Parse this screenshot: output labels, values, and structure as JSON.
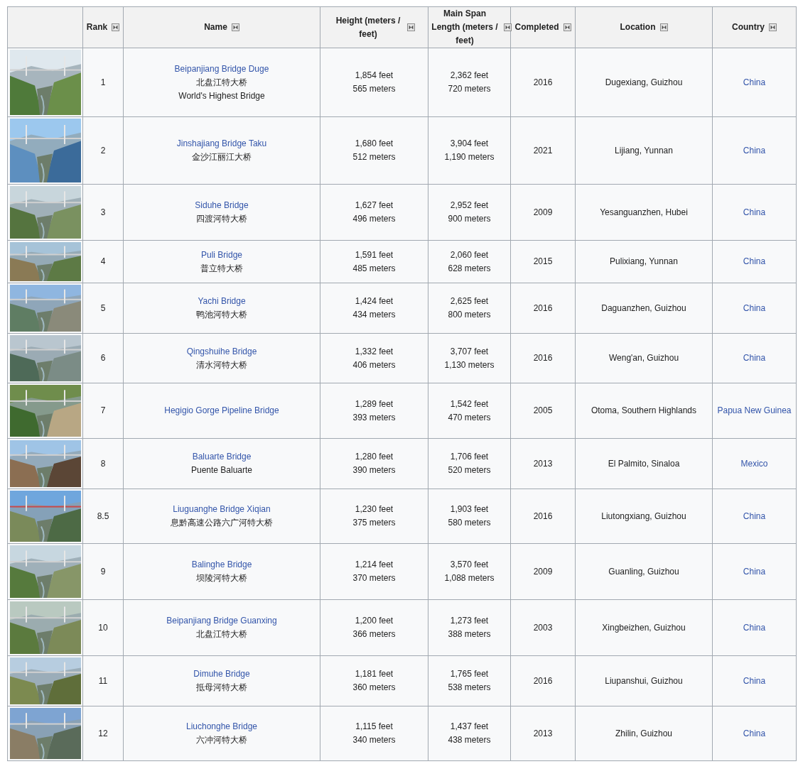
{
  "table": {
    "columns": [
      {
        "sortable": false
      },
      {
        "label": "Rank",
        "sortable": true
      },
      {
        "label": "Name",
        "sortable": true
      },
      {
        "label": "Height (meters / feet)",
        "sortable": true
      },
      {
        "label": "Main Span Length (meters / feet)",
        "sortable": true
      },
      {
        "label": "Completed",
        "sortable": true
      },
      {
        "label": "Location",
        "sortable": true
      },
      {
        "label": "Country",
        "sortable": true
      }
    ],
    "rows": [
      {
        "image": {
          "kind": "picture"
        },
        "rank": "1",
        "name": "Beipanjiang Bridge Duge",
        "subtitles": [
          "北盘江特大桥",
          "World's Highest Bridge"
        ],
        "height": [
          "1,854 feet",
          "565 meters"
        ],
        "span": [
          "2,362 feet",
          "720 meters"
        ],
        "completed": "2016",
        "location": "Dugexiang, Guizhou",
        "country": "China"
      },
      {
        "image": {
          "kind": "picture"
        },
        "rank": "2",
        "name": "Jinshajiang Bridge Taku",
        "subtitles": [
          "金沙江丽江大桥"
        ],
        "height": [
          "1,680 feet",
          "512 meters"
        ],
        "span": [
          "3,904 feet",
          "1,190 meters"
        ],
        "completed": "2021",
        "location": "Lijiang, Yunnan",
        "country": "China"
      },
      {
        "image": {
          "kind": "picture"
        },
        "rank": "3",
        "name": "Siduhe Bridge",
        "subtitles": [
          "四渡河特大桥"
        ],
        "height": [
          "1,627 feet",
          "496 meters"
        ],
        "span": [
          "2,952 feet",
          "900 meters"
        ],
        "completed": "2009",
        "location": "Yesanguanzhen, Hubei",
        "country": "China"
      },
      {
        "image": {
          "kind": "picture"
        },
        "rank": "4",
        "name": "Puli Bridge",
        "subtitles": [
          "普立特大桥"
        ],
        "height": [
          "1,591 feet",
          "485 meters"
        ],
        "span": [
          "2,060 feet",
          "628 meters"
        ],
        "completed": "2015",
        "location": "Pulixiang, Yunnan",
        "country": "China"
      },
      {
        "image": {
          "kind": "picture"
        },
        "rank": "5",
        "name": "Yachi Bridge",
        "subtitles": [
          "鸭池河特大桥"
        ],
        "height": [
          "1,424 feet",
          "434 meters"
        ],
        "span": [
          "2,625 feet",
          "800 meters"
        ],
        "completed": "2016",
        "location": "Daguanzhen, Guizhou",
        "country": "China"
      },
      {
        "image": {
          "kind": "picture"
        },
        "rank": "6",
        "name": "Qingshuihe Bridge",
        "subtitles": [
          "清水河特大桥"
        ],
        "height": [
          "1,332 feet",
          "406 meters"
        ],
        "span": [
          "3,707 feet",
          "1,130 meters"
        ],
        "completed": "2016",
        "location": "Weng'an, Guizhou",
        "country": "China"
      },
      {
        "image": {
          "kind": "picture"
        },
        "rank": "7",
        "name": "Hegigio Gorge Pipeline Bridge",
        "subtitles": [],
        "height": [
          "1,289 feet",
          "393 meters"
        ],
        "span": [
          "1,542 feet",
          "470 meters"
        ],
        "completed": "2005",
        "location": "Otoma, Southern Highlands",
        "country": "Papua New Guinea"
      },
      {
        "image": {
          "kind": "picture"
        },
        "rank": "8",
        "name": "Baluarte Bridge",
        "subtitles": [
          "Puente Baluarte"
        ],
        "height": [
          "1,280 feet",
          "390 meters"
        ],
        "span": [
          "1,706 feet",
          "520 meters"
        ],
        "completed": "2013",
        "location": "El Palmito, Sinaloa",
        "country": "Mexico"
      },
      {
        "image": {
          "kind": "picture"
        },
        "rank": "8.5",
        "name": "Liuguanghe Bridge Xiqian",
        "subtitles": [
          "息黔高速公路六广河特大桥"
        ],
        "height": [
          "1,230 feet",
          "375 meters"
        ],
        "span": [
          "1,903 feet",
          "580 meters"
        ],
        "completed": "2016",
        "location": "Liutongxiang, Guizhou",
        "country": "China"
      },
      {
        "image": {
          "kind": "picture"
        },
        "rank": "9",
        "name": "Balinghe Bridge",
        "subtitles": [
          "坝陵河特大桥"
        ],
        "height": [
          "1,214 feet",
          "370 meters"
        ],
        "span": [
          "3,570 feet",
          "1,088 meters"
        ],
        "completed": "2009",
        "location": "Guanling, Guizhou",
        "country": "China"
      },
      {
        "image": {
          "kind": "picture"
        },
        "rank": "10",
        "name": "Beipanjiang Bridge Guanxing",
        "subtitles": [
          "北盘江特大桥"
        ],
        "height": [
          "1,200 feet",
          "366 meters"
        ],
        "span": [
          "1,273 feet",
          "388 meters"
        ],
        "completed": "2003",
        "location": "Xingbeizhen, Guizhou",
        "country": "China"
      },
      {
        "image": {
          "kind": "picture"
        },
        "rank": "11",
        "name": "Dimuhe Bridge",
        "subtitles": [
          "抵母河特大桥"
        ],
        "height": [
          "1,181 feet",
          "360 meters"
        ],
        "span": [
          "1,765 feet",
          "538 meters"
        ],
        "completed": "2016",
        "location": "Liupanshui, Guizhou",
        "country": "China"
      },
      {
        "image": {
          "kind": "picture"
        },
        "rank": "12",
        "name": "Liuchonghe Bridge",
        "subtitles": [
          "六冲河特大桥"
        ],
        "height": [
          "1,115 feet",
          "340 meters"
        ],
        "span": [
          "1,437 feet",
          "438 meters"
        ],
        "completed": "2013",
        "location": "Zhilin, Guizhou",
        "country": "China"
      }
    ]
  }
}
